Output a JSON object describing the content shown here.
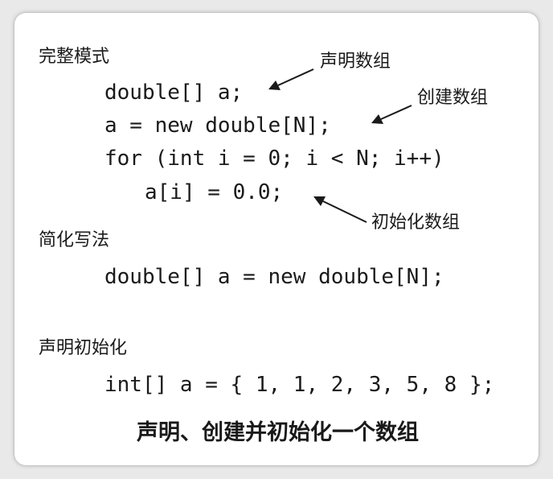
{
  "sections": {
    "full_form": {
      "heading": "完整模式",
      "lines": [
        "double[] a;",
        "a = new double[N];",
        "for (int i = 0; i < N; i++)",
        "a[i] = 0.0;"
      ],
      "annotations": {
        "declare": "声明数组",
        "create": "创建数组",
        "initialize": "初始化数组"
      }
    },
    "short_form": {
      "heading": "简化写法",
      "line": "double[] a = new double[N];"
    },
    "declare_init": {
      "heading": "声明初始化",
      "line": "int[] a = { 1, 1, 2, 3, 5, 8 };"
    }
  },
  "caption": "声明、创建并初始化一个数组"
}
